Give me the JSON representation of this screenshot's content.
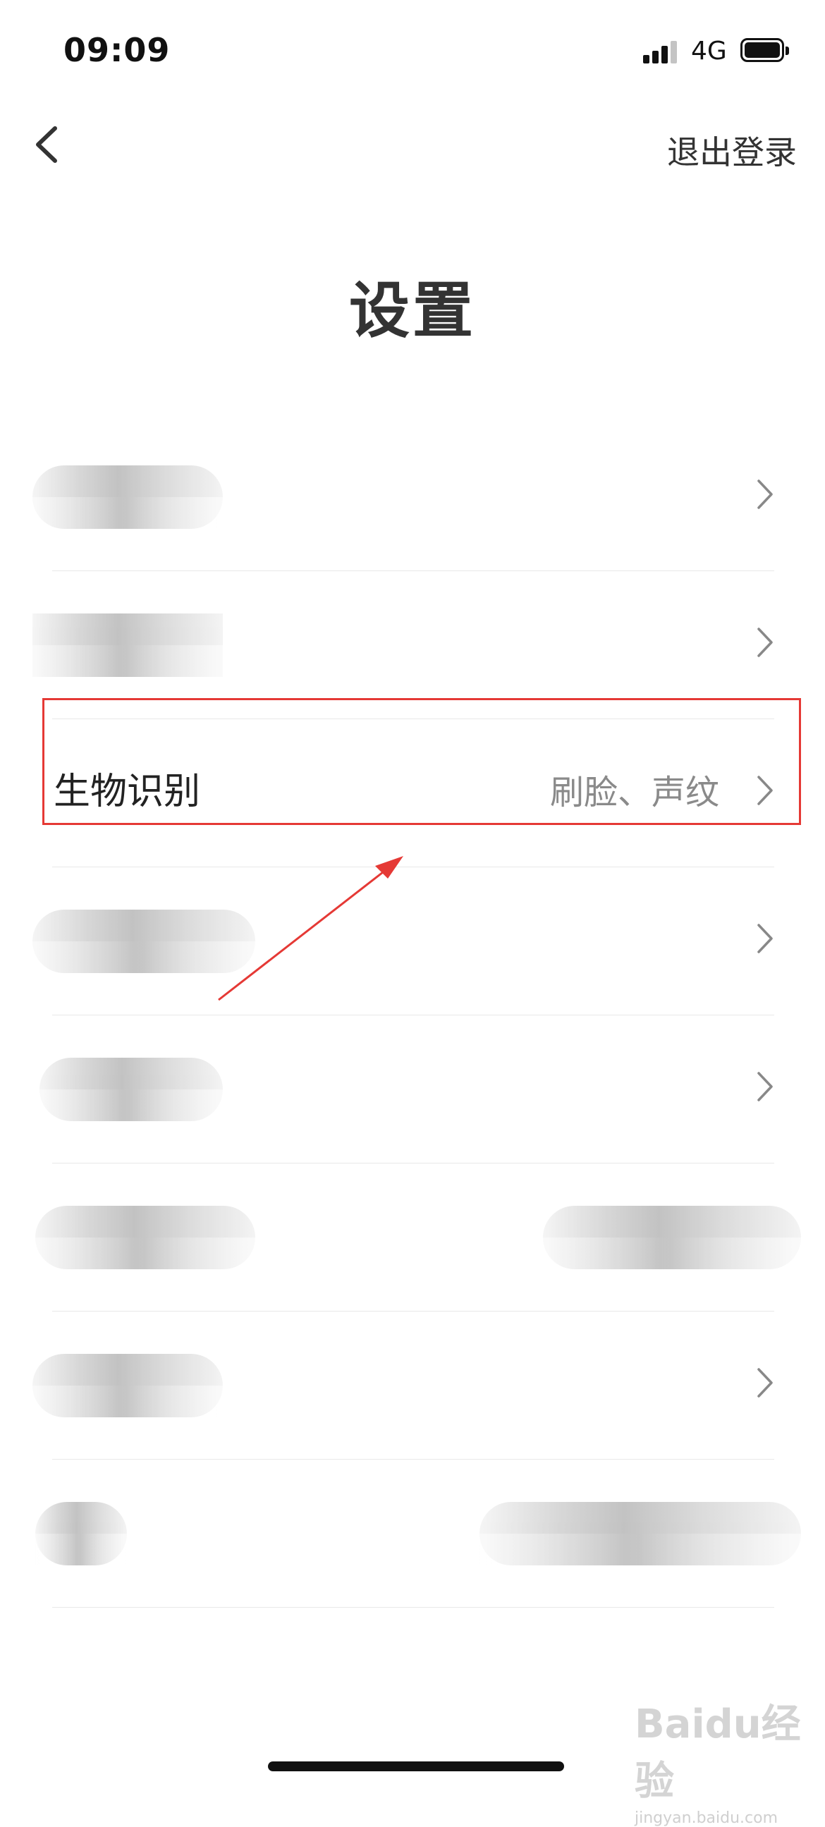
{
  "status_bar": {
    "time": "09:09",
    "network": "4G"
  },
  "nav": {
    "logout_label": "退出登录"
  },
  "page": {
    "title": "设置"
  },
  "settings": {
    "rows": [
      {
        "label": "",
        "value": ""
      },
      {
        "label": "",
        "value": ""
      },
      {
        "label": "生物识别",
        "value": "刷脸、声纹"
      },
      {
        "label": "",
        "value": ""
      },
      {
        "label": "",
        "value": ""
      },
      {
        "label": "",
        "value": ""
      },
      {
        "label": "",
        "value": ""
      },
      {
        "label": "",
        "value": ""
      }
    ]
  },
  "annotation": {
    "highlight_color": "#e53935"
  },
  "watermark": {
    "brand": "Baidu经验",
    "url": "jingyan.baidu.com"
  }
}
